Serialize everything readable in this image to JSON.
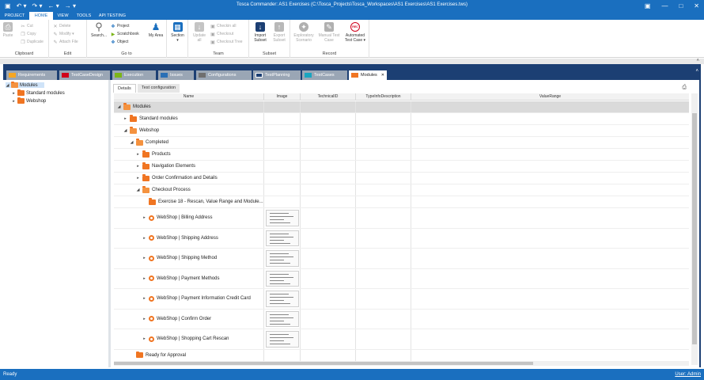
{
  "window": {
    "title": "Tosca Commander: AS1 Exercises (C:\\Tosca_Projects\\Tosca_Workspaces\\AS1 Exercises\\AS1 Exercises.tws)"
  },
  "quick_access": [
    "▣",
    "↶ ▾",
    "↷ ▾",
    "← ▾",
    "→ ▾"
  ],
  "window_buttons": [
    "▣",
    "—",
    "□",
    "✕"
  ],
  "menu": [
    {
      "label": "PROJECT"
    },
    {
      "label": "HOME",
      "active": true
    },
    {
      "label": "VIEW"
    },
    {
      "label": "TOOLS"
    },
    {
      "label": "API TESTING"
    }
  ],
  "ribbon": {
    "clipboard": {
      "label": "Clipboard",
      "paste": "Paste",
      "cut": "Cut",
      "copy": "Copy",
      "duplicate": "Duplicate"
    },
    "edit": {
      "label": "Edit",
      "delete": "Delete",
      "modify": "Modify ▾",
      "attach": "Attach File"
    },
    "goto": {
      "label": "Go to",
      "search": "Search...",
      "project": "Project",
      "scratchbook": "Scratchbook",
      "object": "Object",
      "myarea": "My Area"
    },
    "section": {
      "label": "Section",
      "caret": "▾"
    },
    "team": {
      "label": "Team",
      "update": "Update all",
      "checkin": "Checkin all",
      "checkout": "Checkout",
      "checkout_tree": "Checkout Tree"
    },
    "subset": {
      "label": "Subset",
      "import": "Import Subset",
      "export": "Export Subset"
    },
    "record": {
      "label": "Record",
      "exploratory": "Exploratory Scenario",
      "manual": "Manual Test Case",
      "automated": "Automated Test Case ▾",
      "rec_badge": "REC"
    }
  },
  "window_tabs": [
    {
      "label": "Requirements",
      "color": "#f5a623"
    },
    {
      "label": "TestCaseDesign",
      "color": "#d0021b"
    },
    {
      "label": "Execution",
      "color": "#7cb518"
    },
    {
      "label": "Issues",
      "color": "#2a6fb5"
    },
    {
      "label": "Configurations",
      "color": "#6f6f6f"
    },
    {
      "label": "TestPlanning",
      "color": "#1c3f73"
    },
    {
      "label": "TestCases",
      "color": "#1aa5c0"
    },
    {
      "label": "Modules",
      "color": "#f07522",
      "active": true,
      "close": "✕"
    }
  ],
  "collapse_glyph": "˄",
  "printer_glyph": "⎙",
  "tree": [
    {
      "label": "Modules",
      "expander": "◢",
      "level": 0,
      "selected": true
    },
    {
      "label": "Standard modules",
      "expander": "▸",
      "level": 1
    },
    {
      "label": "Webshop",
      "expander": "▸",
      "level": 1
    }
  ],
  "detail_tabs": [
    {
      "label": "Details",
      "active": true
    },
    {
      "label": "Test configuration"
    }
  ],
  "columns": [
    "Name",
    "Image",
    "TechnicalID",
    "TypeInfoDescription",
    "ValueRange"
  ],
  "rows": [
    {
      "label": "Modules",
      "expander": "◢",
      "level": 0,
      "type": "folder",
      "hl": true
    },
    {
      "label": "Standard modules",
      "expander": "▸",
      "level": 1,
      "type": "folder"
    },
    {
      "label": "Webshop",
      "expander": "◢",
      "level": 1,
      "type": "folder"
    },
    {
      "label": "Completed",
      "expander": "◢",
      "level": 2,
      "type": "folder"
    },
    {
      "label": "Products",
      "expander": "▸",
      "level": 3,
      "type": "folder"
    },
    {
      "label": "Navigation Elements",
      "expander": "▸",
      "level": 3,
      "type": "folder"
    },
    {
      "label": "Order Confirmation and Details",
      "expander": "▸",
      "level": 3,
      "type": "folder"
    },
    {
      "label": "Checkout Process",
      "expander": "◢",
      "level": 3,
      "type": "folder"
    },
    {
      "label": "Exercise 18 - Rescan, Value Range and Module...",
      "expander": "",
      "level": 4,
      "type": "folder"
    },
    {
      "label": "WebShop | Billing Address",
      "expander": "▸",
      "level": 4,
      "type": "module",
      "image": true
    },
    {
      "label": "WebShop | Shipping Address",
      "expander": "▸",
      "level": 4,
      "type": "module",
      "image": true
    },
    {
      "label": "WebShop | Shipping Method",
      "expander": "▸",
      "level": 4,
      "type": "module",
      "image": true
    },
    {
      "label": "WebShop | Payment Methods",
      "expander": "▸",
      "level": 4,
      "type": "module",
      "image": true
    },
    {
      "label": "WebShop | Payment Information Credit Card",
      "expander": "▸",
      "level": 4,
      "type": "module",
      "image": true
    },
    {
      "label": "WebShop | Confirm Order",
      "expander": "▸",
      "level": 4,
      "type": "module",
      "image": true
    },
    {
      "label": "WebShop | Shopping Cart Rescan",
      "expander": "▸",
      "level": 4,
      "type": "module",
      "image": true
    },
    {
      "label": "Ready for Approval",
      "expander": "",
      "level": 2,
      "type": "folder"
    }
  ],
  "status": {
    "left": "Ready",
    "right": "User: Admin"
  }
}
